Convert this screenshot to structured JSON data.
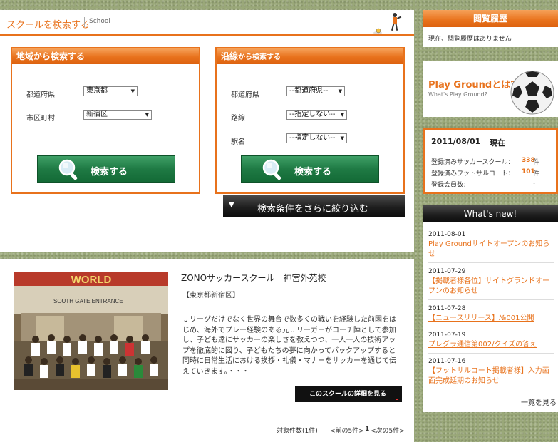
{
  "search": {
    "title": "スクールを検索する",
    "subtitle": "School",
    "area_box": {
      "title": "地域から検索する",
      "prefecture_label": "都道府県",
      "prefecture_value": "東京都",
      "city_label": "市区町村",
      "city_value": "新宿区",
      "button_label": "検索する"
    },
    "line_box": {
      "title_main": "沿線",
      "title_rest": "から検索する",
      "prefecture_label": "都道府県",
      "prefecture_value": "--都道府県--",
      "line_label": "路線",
      "line_value": "--指定しない--",
      "station_label": "駅名",
      "station_value": "--指定しない--",
      "button_label": "検索する"
    },
    "refine_label": "検索条件をさらに絞り込む"
  },
  "result": {
    "school_name": "ZONOサッカースクール　神宮外苑校",
    "area": "【東京都新宿区】",
    "description": "Ｊリーグだけでなく世界の舞台で数多くの戦いを経験した前園をはじめ、海外でプレー経験のある元Ｊリーガーがコーチ陣として参加し、子ども達にサッカーの楽しさを教えつつ、一人一人の技術アップを徹底的に図り、子どもたちの夢に向かってバックアップすると同時に日常生活における挨拶・礼儀・マナーをサッカーを通じて伝えていきます。・・・",
    "detail_label": "このスクールの詳細を見る",
    "photo_sign_top": "WORLD",
    "photo_sign": "SOUTH GATE ENTRANCE",
    "count_text": "対象件数(1件)",
    "prev_text": "<前の5件>",
    "page_number": "1",
    "next_text": "<次の5件>"
  },
  "history": {
    "title": "閲覧履歴",
    "empty_text": "現在、閲覧履歴はありません"
  },
  "banner": {
    "title": "Play Groundとは?",
    "subtitle": "What's Play Ground?"
  },
  "stats": {
    "date": "2011/08/01",
    "current_label": "現在",
    "items": [
      {
        "label": "登録済みサッカースクール：",
        "value": "338",
        "unit": "件"
      },
      {
        "label": "登録済みフットサルコート：",
        "value": "101",
        "unit": "件"
      },
      {
        "label": "登録会員数：",
        "value": "",
        "unit": "-"
      }
    ]
  },
  "news": {
    "title": "What's new!",
    "items": [
      {
        "date": "2011-08-01",
        "text": "Play Groundサイトオープンのお知らせ"
      },
      {
        "date": "2011-07-29",
        "text": "【掲載者様各位】サイトグランドオープンのお知らせ"
      },
      {
        "date": "2011-07-28",
        "text": "【ニュースリリース】№001公開"
      },
      {
        "date": "2011-07-19",
        "text": "プレグラ通信第002/クイズの答え"
      },
      {
        "date": "2011-07-16",
        "text": "【フットサルコート掲載者様】入力画面完成延期のお知らせ"
      }
    ],
    "more_label": "一覧を見る"
  },
  "colors": {
    "accent": "#e8721c",
    "green_button": "#1f7a44",
    "dark_button": "#1e1e1e"
  }
}
